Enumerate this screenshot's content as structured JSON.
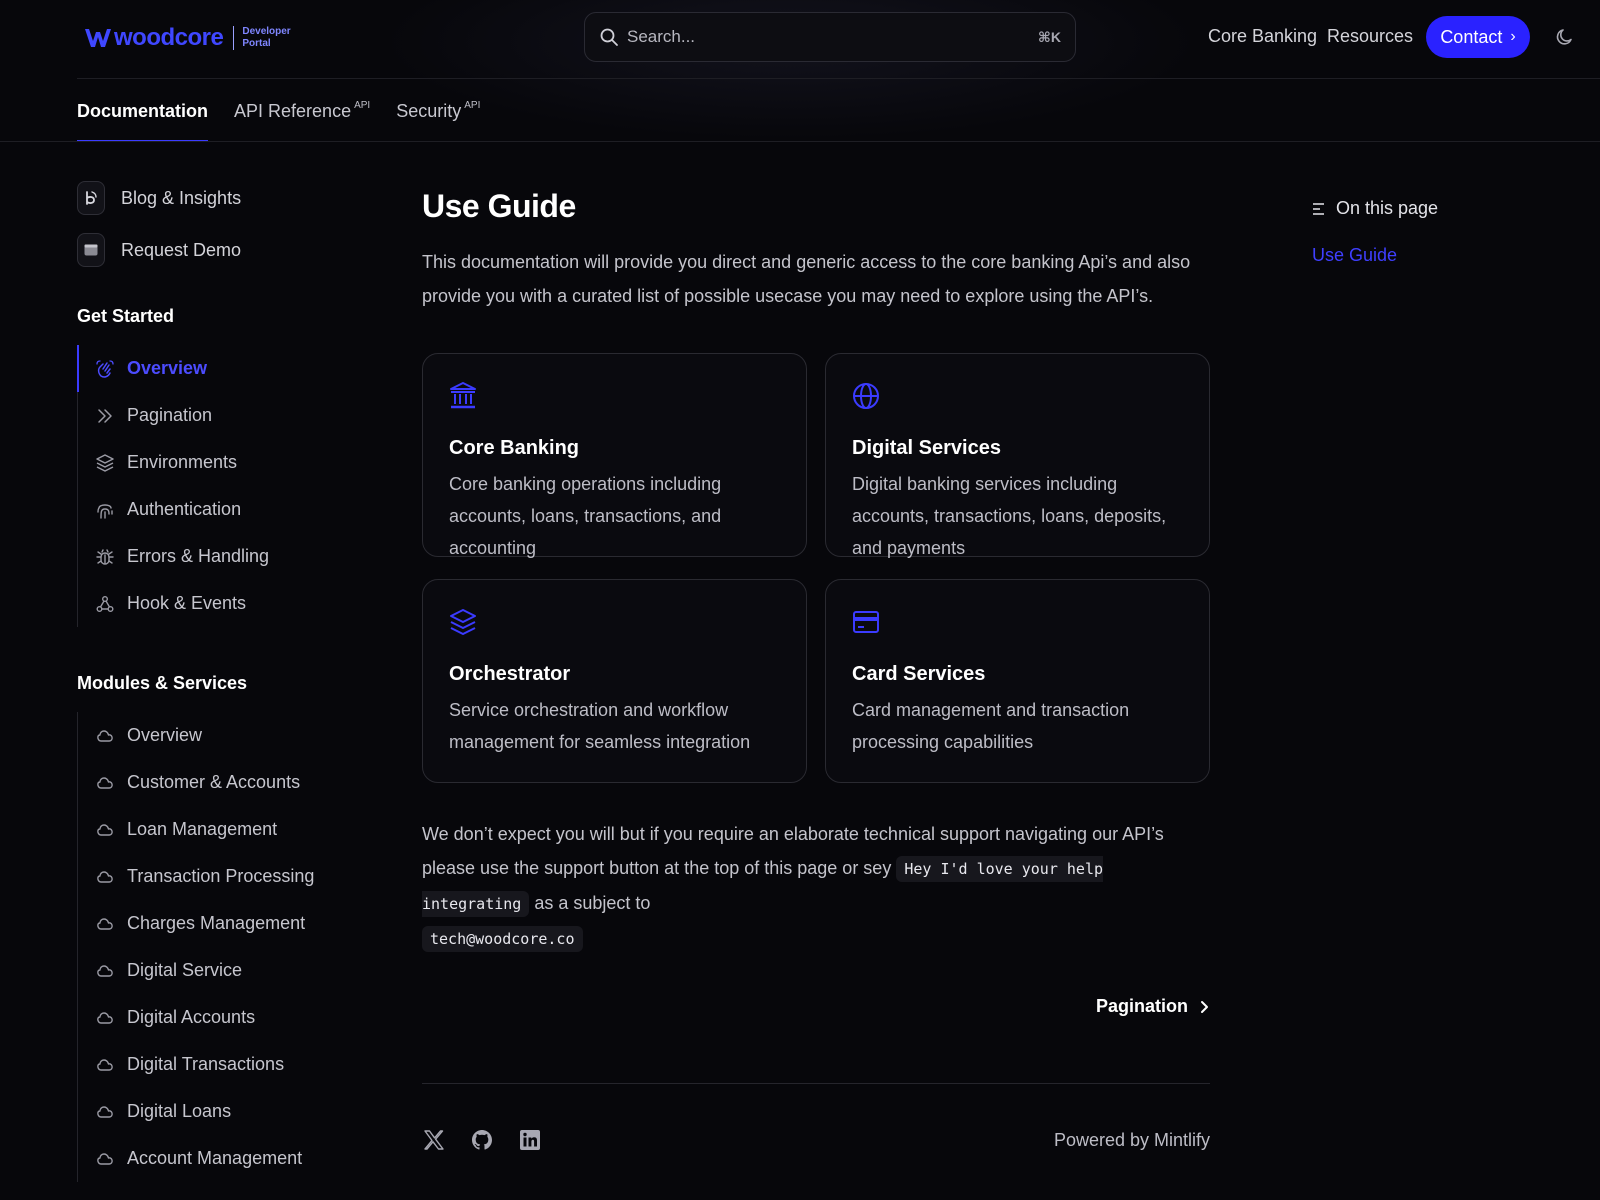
{
  "header": {
    "logo_word": "woodcore",
    "logo_sub_1": "Developer",
    "logo_sub_2": "Portal",
    "search_placeholder": "Search...",
    "search_shortcut": "⌘K",
    "nav": [
      "Core Banking",
      "Resources"
    ],
    "contact_label": "Contact"
  },
  "tabs": [
    {
      "label": "Documentation",
      "badge": ""
    },
    {
      "label": "API Reference",
      "badge": "API"
    },
    {
      "label": "Security",
      "badge": "API"
    }
  ],
  "sidebar": {
    "promo": [
      "Blog & Insights",
      "Request Demo"
    ],
    "get_started_title": "Get Started",
    "get_started": [
      {
        "label": "Overview",
        "icon": "hand-wave-icon",
        "active": true
      },
      {
        "label": "Pagination",
        "icon": "chevrons-right-icon"
      },
      {
        "label": "Environments",
        "icon": "layers-icon"
      },
      {
        "label": "Authentication",
        "icon": "fingerprint-icon"
      },
      {
        "label": "Errors & Handling",
        "icon": "bug-icon"
      },
      {
        "label": "Hook & Events",
        "icon": "webhook-icon"
      }
    ],
    "modules_title": "Modules & Services",
    "modules": [
      "Overview",
      "Customer & Accounts",
      "Loan Management",
      "Transaction Processing",
      "Charges Management",
      "Digital Service",
      "Digital Accounts",
      "Digital Transactions",
      "Digital Loans",
      "Account Management"
    ]
  },
  "main": {
    "title": "Use Guide",
    "intro": "This documentation will provide you direct and generic access to the core banking Api’s and also provide you with a curated list of possible usecase you may need to explore using the API’s.",
    "cards": [
      {
        "title": "Core Banking",
        "desc": "Core banking operations including accounts, loans, transactions, and accounting",
        "icon": "bank-icon"
      },
      {
        "title": "Digital Services",
        "desc": "Digital banking services including accounts, transactions, loans, deposits, and payments",
        "icon": "globe-icon"
      },
      {
        "title": "Orchestrator",
        "desc": "Service orchestration and workflow management for seamless integration",
        "icon": "layers-icon"
      },
      {
        "title": "Card Services",
        "desc": "Card management and transaction processing capabilities",
        "icon": "credit-card-icon"
      }
    ],
    "support_1": "We don’t expect you will but if you require an elaborate technical support navigating our API’s please use the support button at the top of this page or sey",
    "support_code_1": "Hey I'd love your help integrating",
    "support_2": "as a subject to",
    "support_code_2": "tech@woodcore.co",
    "next_label": "Pagination",
    "powered_by": "Powered by Mintlify"
  },
  "toc": {
    "title": "On this page",
    "items": [
      "Use Guide"
    ]
  },
  "colors": {
    "accent": "#2a22ff",
    "accent_text": "#4c4cff",
    "background": "#07070b"
  }
}
